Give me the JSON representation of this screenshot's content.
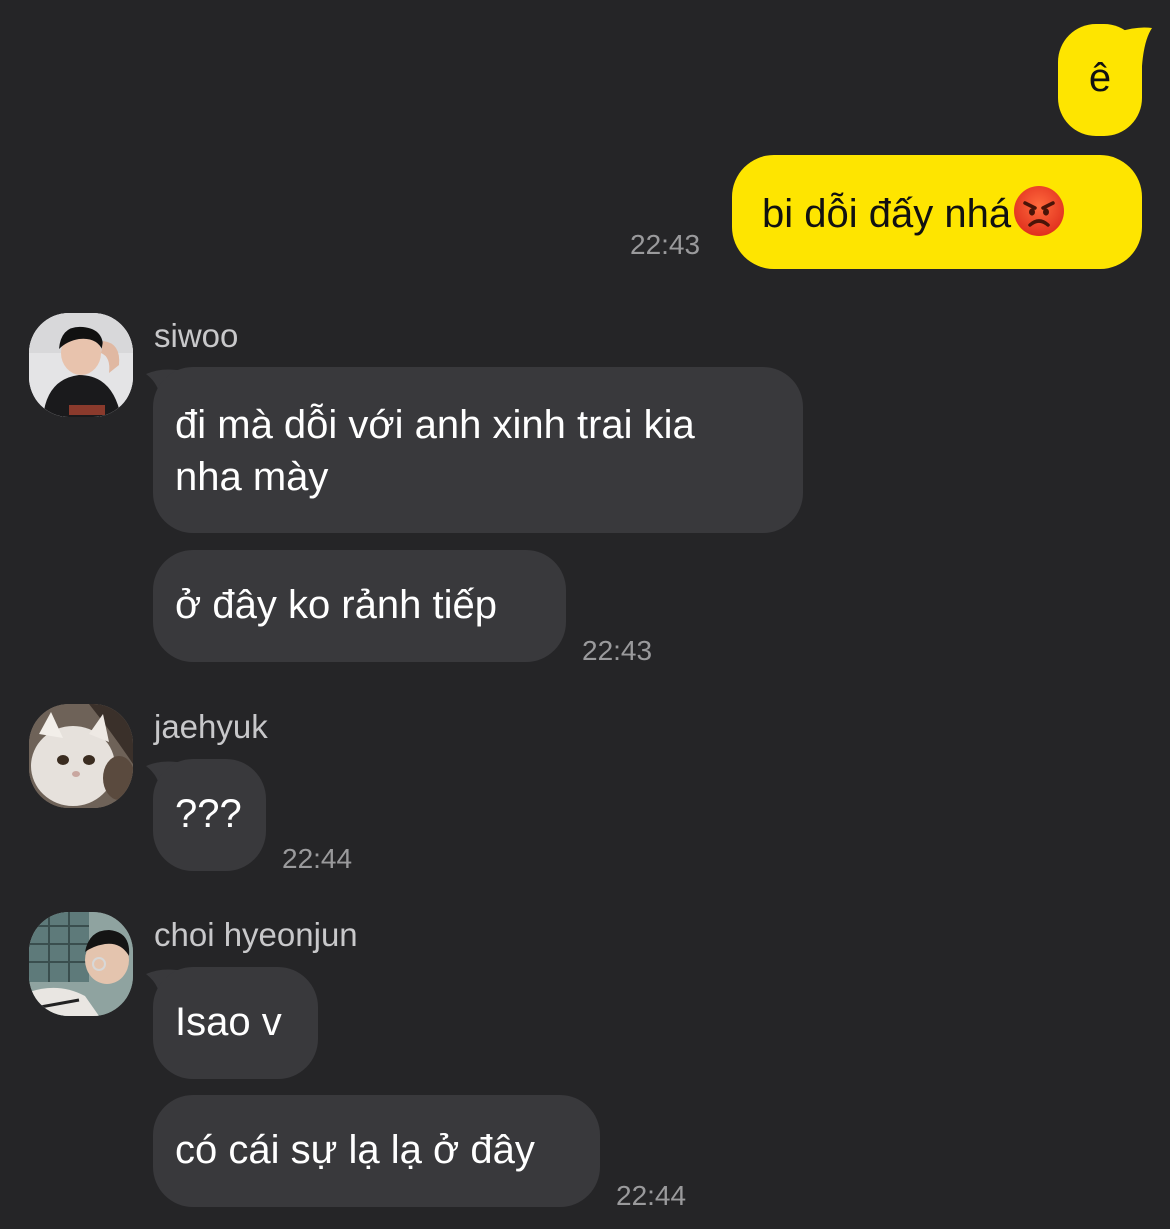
{
  "messages_out": [
    {
      "text": "ê"
    },
    {
      "text": "bi dỗi đấy nhá",
      "emoji": "angry-face-icon",
      "time": "22:43"
    }
  ],
  "groups": [
    {
      "sender": "siwoo",
      "messages": [
        "đi mà dỗi với anh xinh trai kia",
        "nha mày",
        "ở đây ko rảnh tiếp"
      ],
      "time": "22:43"
    },
    {
      "sender": "jaehyuk",
      "messages": [
        "???"
      ],
      "time": "22:44"
    },
    {
      "sender": "choi hyeonjun",
      "messages": [
        "Isao v",
        "có cái sự lạ lạ ở đây"
      ],
      "time": "22:44"
    }
  ],
  "colors": {
    "background": "#252527",
    "outgoing_bubble": "#fee500",
    "incoming_bubble": "#39393c",
    "timestamp": "#9a9a9c"
  }
}
